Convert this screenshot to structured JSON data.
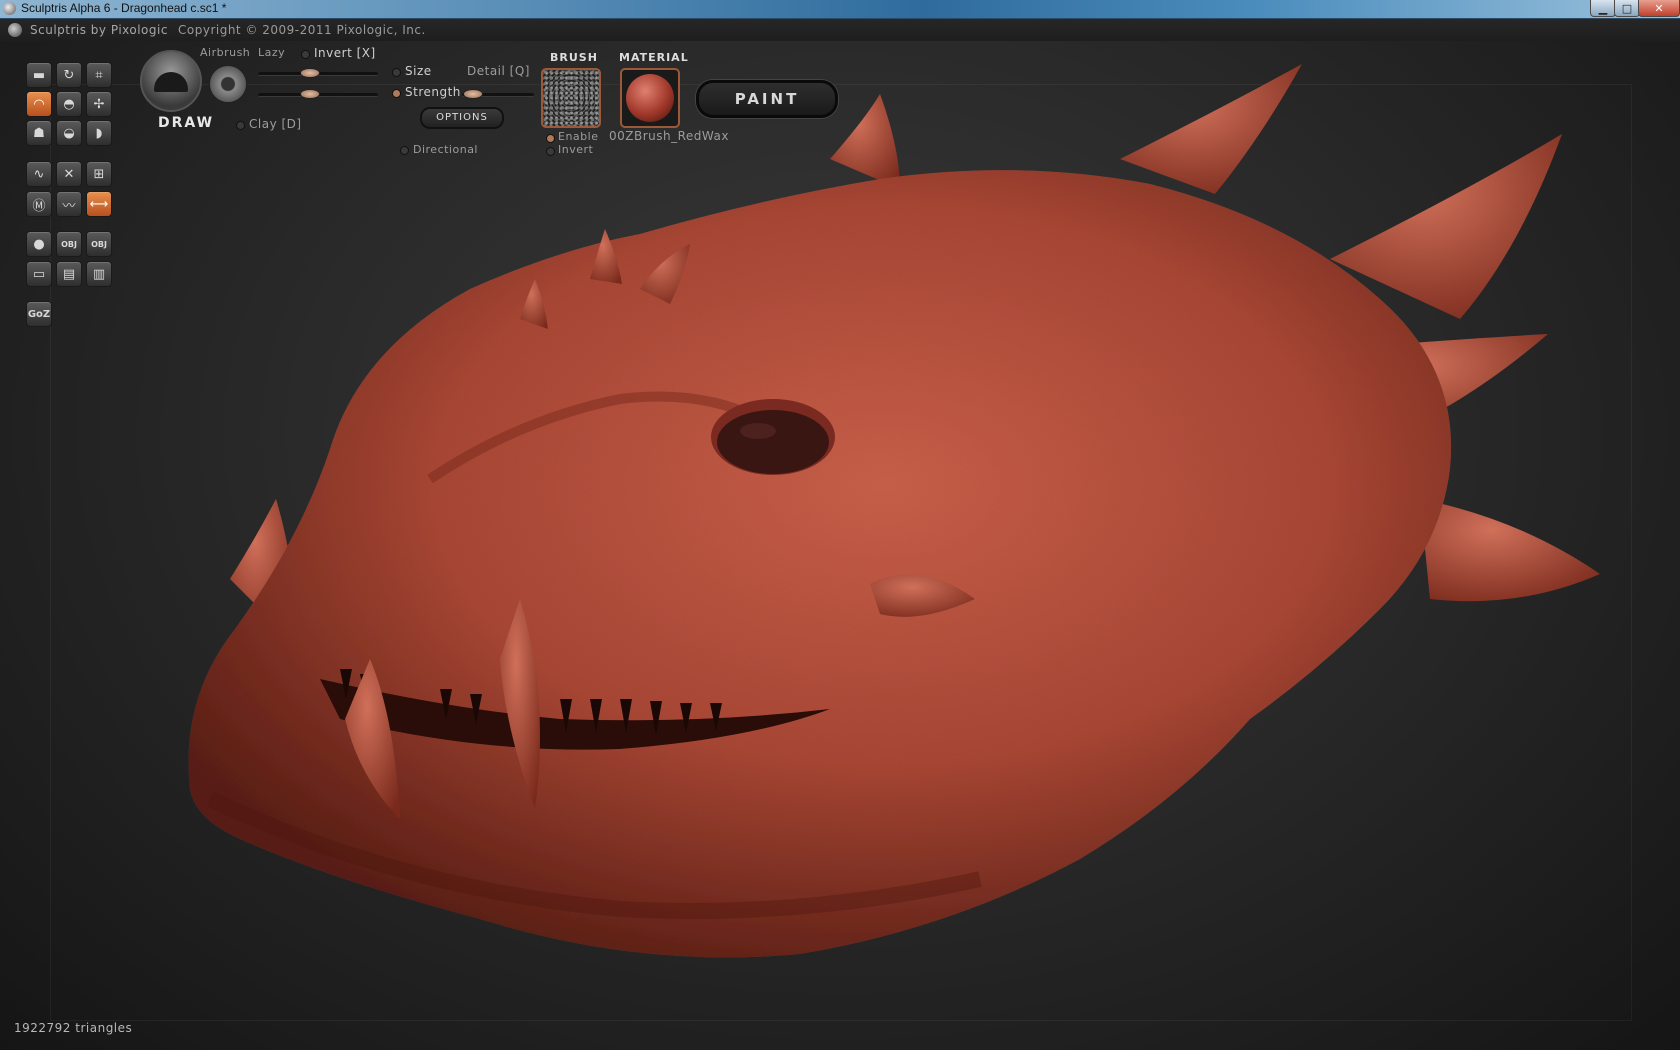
{
  "window": {
    "title": "Sculptris Alpha 6 - Dragonhead c.sc1 *",
    "minimize": "▁",
    "maximize": "□",
    "close": "✕"
  },
  "header": {
    "app_by": "Sculptris by Pixologic",
    "copyright": "Copyright © 2009-2011 Pixologic, Inc."
  },
  "brush": {
    "name": "DRAW",
    "airbrush": "Airbrush",
    "lazy": "Lazy",
    "invert": "Invert [X]",
    "size": "Size",
    "strength": "Strength",
    "detail": "Detail [Q]",
    "clay": "Clay [D]",
    "options": "OPTIONS",
    "directional": "Directional"
  },
  "brush_panel": {
    "header": "BRUSH",
    "enable": "Enable",
    "invert": "Invert"
  },
  "material_panel": {
    "header": "MATERIAL",
    "name": "00ZBrush_RedWax"
  },
  "paint_button": "PAINT",
  "tools": {
    "goz": "GoZ",
    "obj1": "OBJ",
    "obj2": "OBJ"
  },
  "status": {
    "triangles": "1922792 triangles"
  },
  "colors": {
    "accent_orange": "#d2743a",
    "model_red": "#b8503e"
  }
}
